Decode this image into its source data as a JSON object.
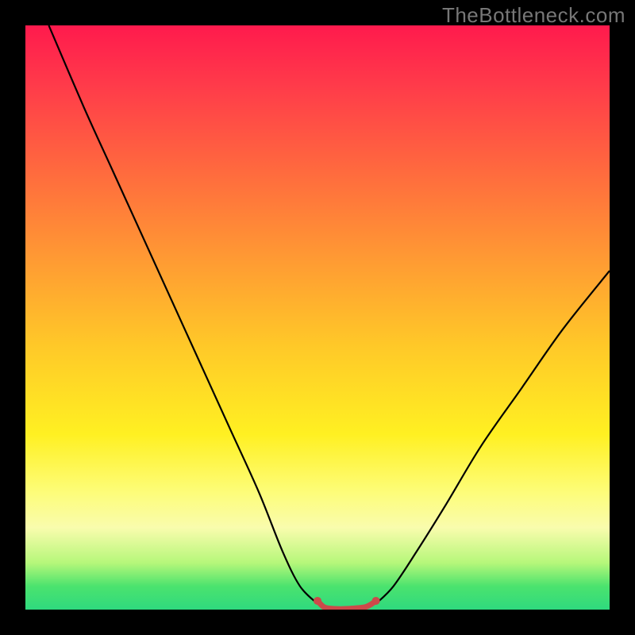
{
  "watermark": "TheBottleneck.com",
  "chart_data": {
    "type": "line",
    "title": "",
    "xlabel": "",
    "ylabel": "",
    "xlim": [
      0,
      100
    ],
    "ylim": [
      0,
      100
    ],
    "background_gradient": {
      "direction": "vertical",
      "stops": [
        {
          "pos": 0,
          "color": "#ff1a4d"
        },
        {
          "pos": 25,
          "color": "#ff6a3e"
        },
        {
          "pos": 55,
          "color": "#ffc928"
        },
        {
          "pos": 80,
          "color": "#fdfd7a"
        },
        {
          "pos": 96,
          "color": "#4be36e"
        },
        {
          "pos": 100,
          "color": "#2fd97e"
        }
      ]
    },
    "series": [
      {
        "name": "left-black-curve",
        "color": "#000000",
        "x": [
          4,
          10,
          15,
          20,
          25,
          30,
          35,
          40,
          44,
          47,
          50
        ],
        "y": [
          100,
          86,
          75,
          64,
          53,
          42,
          31,
          20,
          10,
          4,
          1
        ]
      },
      {
        "name": "right-black-curve",
        "color": "#000000",
        "x": [
          60,
          63,
          67,
          72,
          78,
          85,
          92,
          100
        ],
        "y": [
          1,
          4,
          10,
          18,
          28,
          38,
          48,
          58
        ]
      },
      {
        "name": "red-trough-curve",
        "color": "#cc4a4a",
        "x": [
          50,
          51,
          52,
          54,
          56,
          58,
          59,
          60
        ],
        "y": [
          1.5,
          0.5,
          0.2,
          0.1,
          0.2,
          0.4,
          0.8,
          1.5
        ]
      }
    ],
    "markers": [
      {
        "name": "trough-marker-left",
        "x": 50,
        "y": 1.5,
        "color": "#cc4a4a"
      },
      {
        "name": "trough-marker-right",
        "x": 60,
        "y": 1.5,
        "color": "#cc4a4a"
      }
    ]
  }
}
